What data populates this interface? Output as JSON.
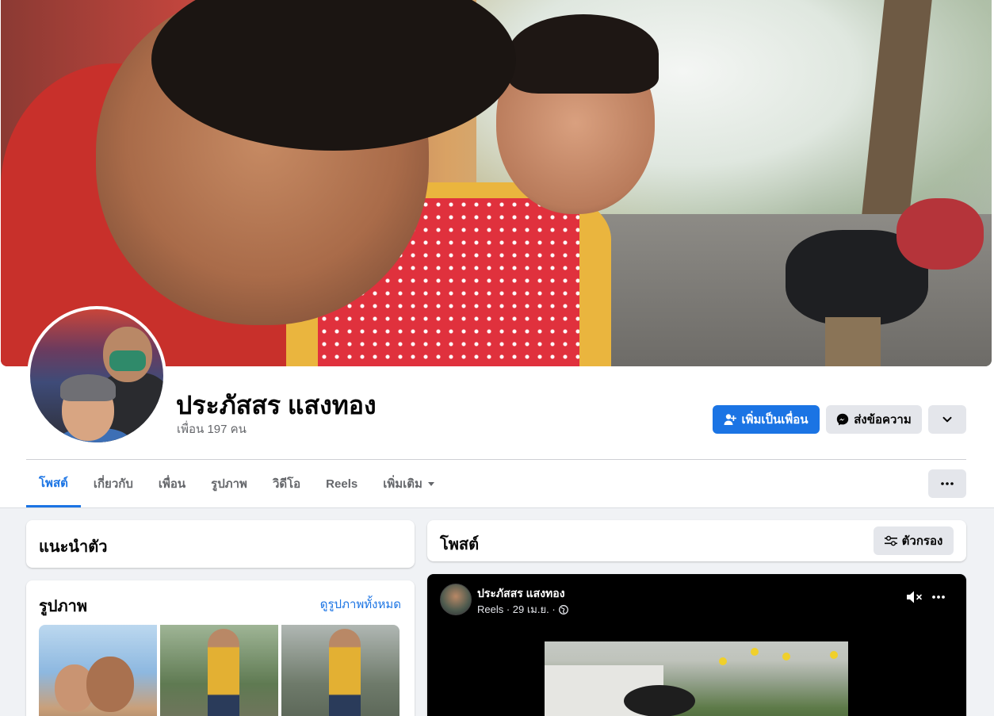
{
  "profile": {
    "name": "ประภัสสร แสงทอง",
    "friends_text": "เพื่อน 197 คน"
  },
  "actions": {
    "add_friend": "เพิ่มเป็นเพื่อน",
    "message": "ส่งข้อความ"
  },
  "tabs": [
    {
      "label": "โพสต์",
      "active": true
    },
    {
      "label": "เกี่ยวกับ",
      "active": false
    },
    {
      "label": "เพื่อน",
      "active": false
    },
    {
      "label": "รูปภาพ",
      "active": false
    },
    {
      "label": "วิดีโอ",
      "active": false
    },
    {
      "label": "Reels",
      "active": false
    },
    {
      "label": "เพิ่มเติม",
      "active": false
    }
  ],
  "intro": {
    "title": "แนะนำตัว"
  },
  "photos": {
    "title": "รูปภาพ",
    "see_all": "ดูรูปภาพทั้งหมด"
  },
  "posts": {
    "title": "โพสต์",
    "filter_label": "ตัวกรอง"
  },
  "post": {
    "author": "ประภัสสร แสงทอง",
    "meta": "Reels · 29 เม.ย. ·"
  },
  "colors": {
    "accent": "#1b74e4",
    "background": "#f0f2f5",
    "secondary_button": "#e4e6eb"
  },
  "icons": {
    "add_friend": "person-plus-icon",
    "message": "messenger-icon",
    "chevron": "chevron-down-icon",
    "more": "more-horizontal-icon",
    "filter": "filter-sliders-icon",
    "mute": "speaker-muted-icon",
    "audience": "globe-icon"
  }
}
